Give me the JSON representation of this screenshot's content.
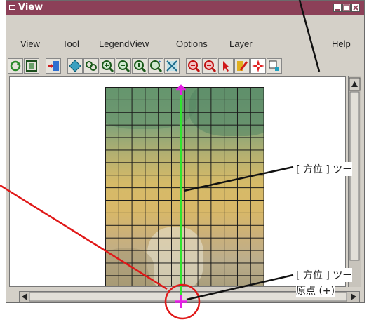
{
  "window": {
    "title": "View",
    "controls": [
      "minimize-icon",
      "maximize-icon",
      "close-icon"
    ]
  },
  "menubar": {
    "items": [
      "View",
      "Tool",
      "LegendView",
      "Options",
      "Layer",
      "Help"
    ]
  },
  "toolbar": {
    "tools": [
      "redraw-icon",
      "full-extent-icon",
      "add-layer-icon",
      "layer-manager-icon",
      "zoom-box-icon",
      "zoom-in-icon",
      "zoom-out-icon",
      "zoom-one-icon",
      "zoom-previous-icon",
      "fit-grid-icon",
      "zoom-in-red-icon",
      "zoom-out-red-icon",
      "select-arrow-icon",
      "edit-pencil-icon",
      "direction-tool-icon",
      "stretch-window-icon"
    ],
    "active_tool": "direction-tool-icon"
  },
  "callouts": {
    "direction_tool": "[ 方位 ] ツー",
    "direction_origin_line1": "[ 方位 ] ツー",
    "direction_origin_line2": "原点 (+)"
  },
  "colors": {
    "title_bar": "#8c4058",
    "direction_line": "#2ee62e",
    "endpoints": "#e61ee6",
    "callout_circle": "#e01818"
  }
}
